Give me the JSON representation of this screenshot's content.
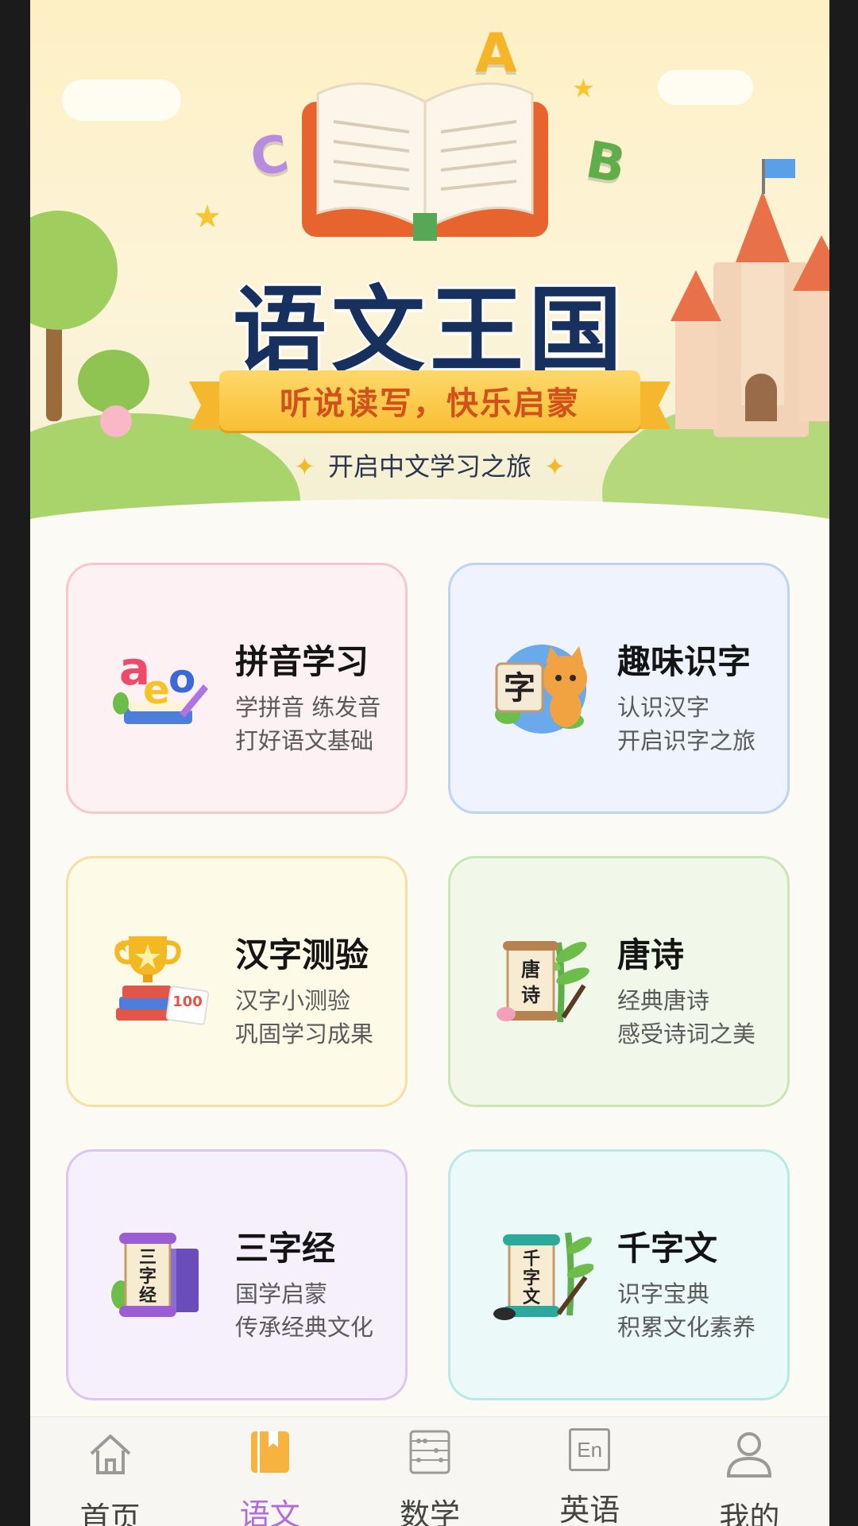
{
  "banner": {
    "title": "语文王国",
    "slogan": "听说读写，快乐启蒙",
    "subtitle": "开启中文学习之旅",
    "letters": [
      "A",
      "B",
      "C"
    ]
  },
  "cards": [
    {
      "title": "拼音学习",
      "line1": "学拼音 练发音",
      "line2": "打好语文基础",
      "icon": "aeo-letters-icon",
      "glyph": "aeo",
      "bg": "#fdf1f3",
      "border": "#f6c7d0"
    },
    {
      "title": "趣味识字",
      "line1": "认识汉字",
      "line2": "开启识字之旅",
      "icon": "cat-character-icon",
      "glyph": "字",
      "bg": "#eef3fd",
      "border": "#bed3f2"
    },
    {
      "title": "汉字测验",
      "line1": "汉字小测验",
      "line2": "巩固学习成果",
      "icon": "trophy-books-icon",
      "glyph": "100",
      "bg": "#fefae8",
      "border": "#f6dfa6"
    },
    {
      "title": "唐诗",
      "line1": "经典唐诗",
      "line2": "感受诗词之美",
      "icon": "poetry-scroll-icon",
      "glyph": "唐诗",
      "bg": "#f1f8ea",
      "border": "#cbe5b5"
    },
    {
      "title": "三字经",
      "line1": "国学启蒙",
      "line2": "传承经典文化",
      "icon": "classic-scroll-icon",
      "glyph": "三字经",
      "bg": "#f6f0fc",
      "border": "#dcc6f0"
    },
    {
      "title": "千字文",
      "line1": "识字宝典",
      "line2": "积累文化素养",
      "icon": "calligraphy-scroll-icon",
      "glyph": "千字文",
      "bg": "#ebfaf8",
      "border": "#b8e9e3"
    }
  ],
  "tabs": [
    {
      "label": "首页",
      "icon": "home-icon",
      "active": false
    },
    {
      "label": "语文",
      "icon": "book-icon",
      "active": true
    },
    {
      "label": "数学",
      "icon": "abacus-icon",
      "active": false
    },
    {
      "label": "英语",
      "icon": "english-en-icon",
      "glyph": "En",
      "active": false
    },
    {
      "label": "我的",
      "icon": "user-icon",
      "active": false
    }
  ],
  "colors": {
    "title": "#17305e",
    "ribbon_text": "#d2511a",
    "active_tab": "#b06cd8"
  }
}
